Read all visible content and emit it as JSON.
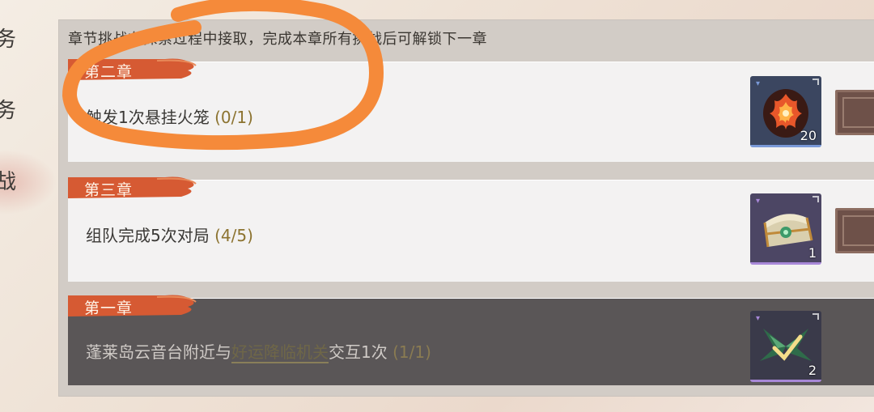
{
  "sidebar": {
    "tabs": [
      {
        "label": "务"
      },
      {
        "label": "务"
      },
      {
        "label": "战"
      }
    ]
  },
  "panel": {
    "header": "章节挑战在探索过程中接取，完成本章所有挑战后可解锁下一章"
  },
  "tasks": [
    {
      "chapter": "第二章",
      "description": "触发1次悬挂火笼",
      "progress": "(0/1)",
      "reward": {
        "icon": "flame-mask-icon",
        "count": "20",
        "tier_color": "#7a9ad8",
        "bg": "#3b4660"
      },
      "state": "active"
    },
    {
      "chapter": "第三章",
      "description": "组队完成5次对局",
      "progress": "(4/5)",
      "reward": {
        "icon": "treasure-chest-icon",
        "count": "1",
        "tier_color": "#a888d8",
        "bg": "#4c4664"
      },
      "state": "active"
    },
    {
      "chapter": "第一章",
      "description_prefix": "蓬莱岛云音台附近与",
      "description_link": "好运降临机关",
      "description_suffix": "交互1次",
      "progress": "(1/1)",
      "reward": {
        "icon": "jade-wings-icon",
        "count": "2",
        "tier_color": "#a888d8",
        "bg": "#3a3a4a"
      },
      "state": "completed"
    }
  ],
  "colors": {
    "ribbon": "#d65a33",
    "progress": "#8c7330",
    "annotation": "#f58a3a"
  }
}
